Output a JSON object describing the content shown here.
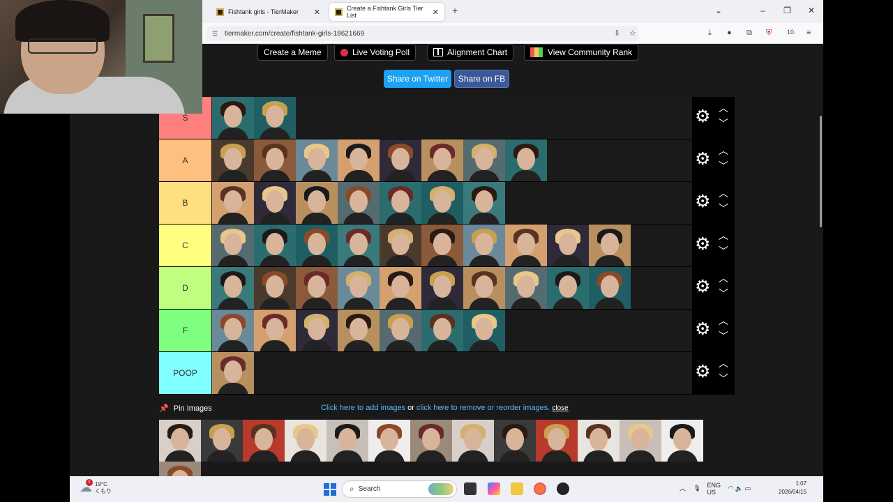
{
  "browser": {
    "tabs": [
      {
        "label": "Fishtank girls - TierMaker"
      },
      {
        "label": "Create a Fishtank Girls Tier List"
      }
    ],
    "url": "tiermaker.com/create/fishtank-girls-18621669",
    "extension_badge": "6",
    "profile_label": "10."
  },
  "toolbar_buttons": [
    {
      "label": "Create a Meme"
    },
    {
      "label": "Live Voting Poll"
    },
    {
      "label": "Alignment Chart"
    },
    {
      "label": "View Community Rank"
    }
  ],
  "share": {
    "twitter": "Share on Twitter",
    "fb": "Share on FB"
  },
  "tiers": [
    {
      "label": "S",
      "color": "#ff7f7f",
      "count": 2
    },
    {
      "label": "A",
      "color": "#ffbf7f",
      "count": 8
    },
    {
      "label": "B",
      "color": "#ffdf7f",
      "count": 7
    },
    {
      "label": "C",
      "color": "#ffff7f",
      "count": 10
    },
    {
      "label": "D",
      "color": "#bfff7f",
      "count": 10
    },
    {
      "label": "F",
      "color": "#7fff7f",
      "count": 7
    },
    {
      "label": "POOP",
      "color": "#7fffff",
      "count": 1
    }
  ],
  "pin": {
    "label": "Pin Images",
    "add_link": "Click here to add images",
    "or": "or",
    "remove_link": "click here to remove or reorder images.",
    "close": "close"
  },
  "taskbar": {
    "weather_temp": "19°C",
    "weather_desc": "くもり",
    "weather_badge": "1",
    "search_placeholder": "Search",
    "lang": "ENG",
    "region": "US",
    "time": "1:07",
    "date": "2026/04/15"
  }
}
